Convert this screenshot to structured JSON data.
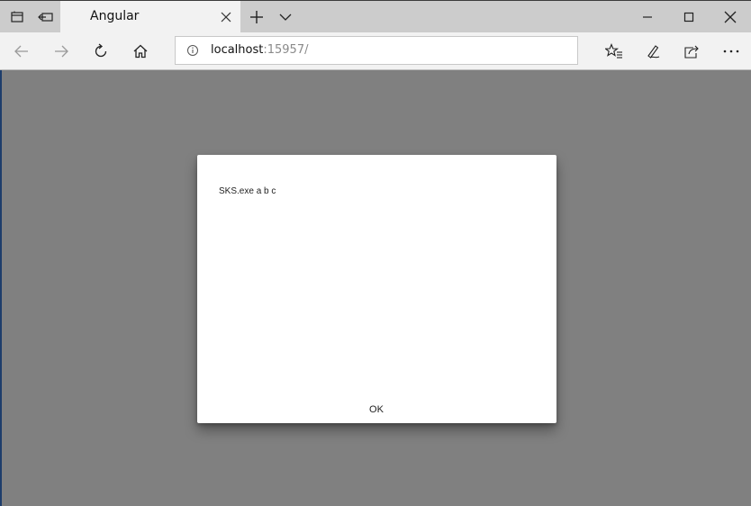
{
  "browser": {
    "tab": {
      "title": "Angular"
    },
    "address": {
      "host": "localhost",
      "path": ":15957/"
    }
  },
  "dialog": {
    "message": "SKS.exe a b c",
    "ok_label": "OK"
  }
}
